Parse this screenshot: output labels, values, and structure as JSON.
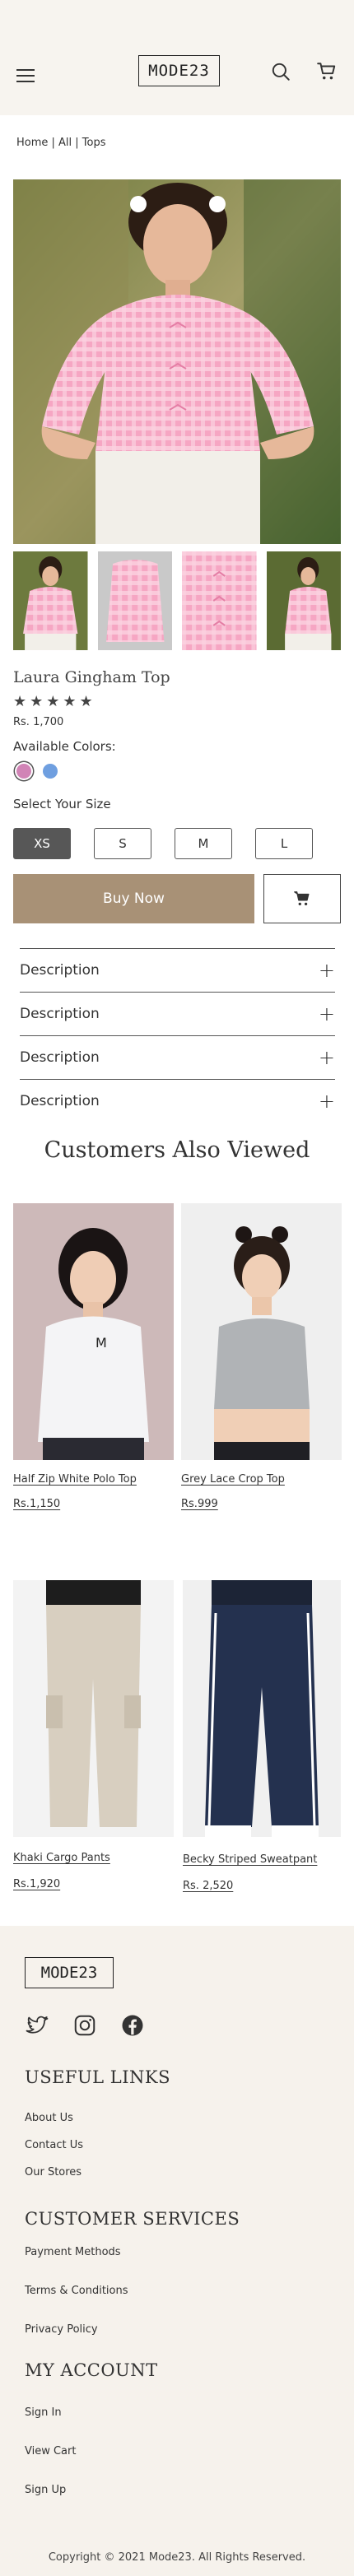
{
  "header": {
    "logo": "MODE23",
    "menu_icon": "hamburger-icon",
    "search_icon": "search-icon",
    "cart_icon": "cart-icon"
  },
  "breadcrumb": "Home | All | Tops",
  "product": {
    "title": "Laura Gingham Top",
    "rating_stars": "★★★★★",
    "price": "Rs. 1,700",
    "available_colors_label": "Available Colors:",
    "colors": [
      "#d184b6",
      "#6f9fe0"
    ],
    "select_size_label": "Select Your Size",
    "sizes": [
      "XS",
      "S",
      "M",
      "L"
    ],
    "selected_size": "XS",
    "buy_now": "Buy Now"
  },
  "accordions": [
    "Description",
    "Description",
    "Description",
    "Description"
  ],
  "customers_also_viewed": {
    "title": "Customers Also Viewed",
    "products": [
      {
        "name": "Half Zip White Polo Top",
        "price": "Rs.1,150"
      },
      {
        "name": "Grey Lace Crop Top",
        "price": "Rs.999"
      },
      {
        "name": "Khaki Cargo Pants",
        "price": "Rs.1,920"
      },
      {
        "name": "Becky Striped Sweatpant",
        "price": "Rs. 2,520"
      }
    ]
  },
  "footer": {
    "logo": "MODE23",
    "social_icons": [
      "twitter-icon",
      "instagram-icon",
      "facebook-icon"
    ],
    "useful_links": {
      "title": "USEFUL LINKS",
      "items": [
        "About Us",
        "Contact Us",
        "Our Stores"
      ]
    },
    "customer_services": {
      "title": "CUSTOMER SERVICES",
      "items": [
        "Payment Methods",
        "Terms & Conditions",
        "Privacy Policy"
      ]
    },
    "my_account": {
      "title": "MY ACCOUNT",
      "items": [
        "Sign In",
        "View Cart",
        "Sign Up"
      ]
    },
    "copyright": "Copyright © 2021 Mode23. All Rights Reserved."
  }
}
